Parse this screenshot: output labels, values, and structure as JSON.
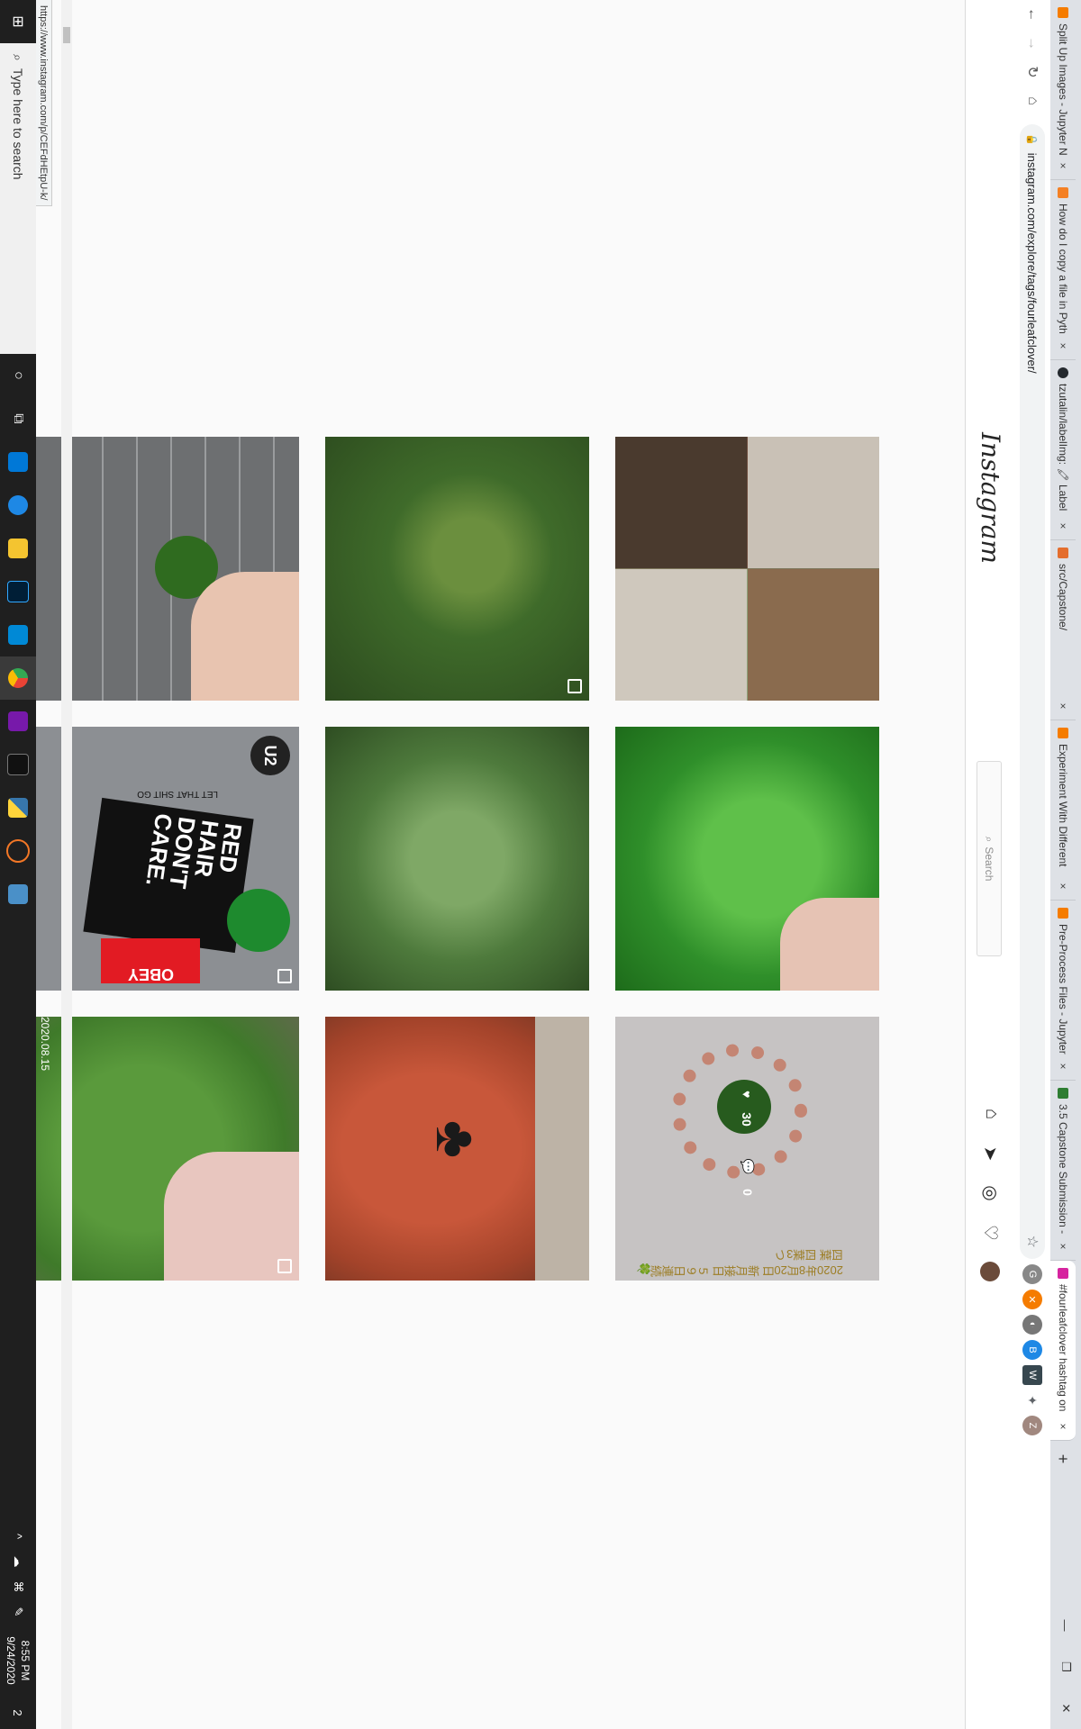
{
  "browser": {
    "tabs": [
      {
        "label": "Split Up Images - Jupyter N",
        "color": "#f57c00"
      },
      {
        "label": "How do I copy a file in Pyth",
        "color": "#f48024"
      },
      {
        "label": "tzutalin/labelImg: 🖍 Label",
        "color": "#24292e"
      },
      {
        "label": "src/Capstone/",
        "color": "#e46e2e"
      },
      {
        "label": "Experiment With Different",
        "color": "#f57c00"
      },
      {
        "label": "Pre-Process Files - Jupyter",
        "color": "#f57c00"
      },
      {
        "label": "3.5 Capstone Submission -",
        "color": "#2e7d32"
      },
      {
        "label": "#fourleafclover hashtag on",
        "color": "#d6249f",
        "active": true
      }
    ],
    "close_glyph": "×",
    "new_tab": "+",
    "url": "instagram.com/explore/tags/fourleafclover/",
    "nav": {
      "back": "←",
      "forward": "→",
      "reload": "↻",
      "home": "⌂"
    },
    "extensions": [
      "G",
      "✕",
      "◐",
      "B",
      "W",
      "✦",
      "Z"
    ],
    "window_controls": [
      "—",
      "❐",
      "✕"
    ],
    "star": "☆"
  },
  "instagram": {
    "logo": "Instagram",
    "search_placeholder": "Search",
    "nav_icons": [
      "home-icon",
      "direct-icon",
      "explore-icon",
      "heart-icon",
      "avatar"
    ],
    "posts": [
      {
        "row": 0,
        "col": 0,
        "desc": "collage room"
      },
      {
        "row": 0,
        "col": 1,
        "desc": "clover in grass",
        "multi": true
      },
      {
        "row": 0,
        "col": 2,
        "desc": "hand holding clover on brick"
      },
      {
        "row": 0,
        "col": 3,
        "desc": "road"
      },
      {
        "row": 1,
        "col": 0,
        "desc": "hand holding four leaf clover"
      },
      {
        "row": 1,
        "col": 1,
        "desc": "clover leaves"
      },
      {
        "row": 1,
        "col": 2,
        "desc": "sticker laptop",
        "sticker_text": [
          "RED",
          "HAIR",
          "DON'T",
          "CARE.",
          "OBEY",
          "U2",
          "LET THAT",
          "SHIT GO"
        ],
        "multi": true
      },
      {
        "row": 1,
        "col": 3,
        "desc": "clover patch"
      },
      {
        "row": 2,
        "col": 0,
        "desc": "bracelet",
        "likes": "30",
        "comments": "0",
        "overlay_text": [
          "2020年8月20日",
          "新月接日",
          "５９日連続🍀四葉",
          "四葉3つ"
        ]
      },
      {
        "row": 2,
        "col": 1,
        "desc": "clover tattoo"
      },
      {
        "row": 2,
        "col": 2,
        "desc": "hand holding tiny clover",
        "date_text": "2020.08.15",
        "multi": true
      },
      {
        "row": 2,
        "col": 3,
        "desc": "green lettering"
      }
    ]
  },
  "status_url": "https://www.instagram.com/p/CEFdHEtpU-k/",
  "taskbar": {
    "start_glyph": "⊞",
    "search_placeholder": "Type here to search",
    "cortana": "○",
    "taskview": "⧉",
    "time": "8:55 PM",
    "date": "9/24/2020",
    "tray": [
      "^",
      "☁",
      "⌘",
      "✎"
    ],
    "notification": "2"
  }
}
